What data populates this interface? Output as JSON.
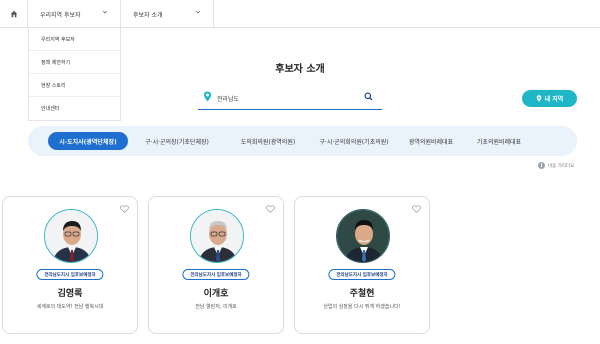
{
  "nav": {
    "select1": "우리지역 후보자",
    "select2": "후보자 소개",
    "dropdown_items": [
      "우리지역 후보자",
      "정책 제안하기",
      "현장 스토리",
      "안내센터"
    ]
  },
  "page_title": "후보자 소개",
  "search": {
    "value": "전라남도"
  },
  "location_button": "내 지역",
  "tabs": [
    {
      "label": "시·도지사(광역단체장)",
      "active": true
    },
    {
      "label": "구·시·군의장(기초단체장)",
      "active": false
    },
    {
      "label": "도의회의원(광역의원)",
      "active": false
    },
    {
      "label": "구·시·군의회의원(기초의원)",
      "active": false
    },
    {
      "label": "광역의원비례대표",
      "active": false
    },
    {
      "label": "기초의원비례대표",
      "active": false
    }
  ],
  "hide_label": "비움 가리다요",
  "candidates": [
    {
      "badge": "전라남도지사 입후보예정자",
      "name": "김영록",
      "slogan": "세계로의 대도약! 전남 행복시대"
    },
    {
      "badge": "전라남도지사 입후보예정자",
      "name": "이개호",
      "slogan": "전남 웰린저, 이개호"
    },
    {
      "badge": "전라남도지사 입후보예정자",
      "name": "주철현",
      "slogan": "산업의 심장을 다시 뛰게 하겠습니다!"
    }
  ],
  "colors": {
    "primary": "#1f6fd0",
    "accent": "#1fb7c7",
    "tab_bg": "#eaf3fb"
  }
}
